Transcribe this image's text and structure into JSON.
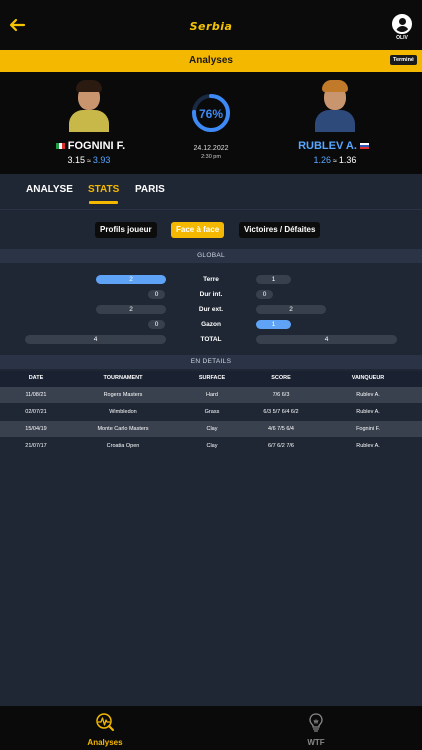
{
  "header": {
    "brand": "Serbia",
    "user_name": "OLIV"
  },
  "subheader": {
    "title": "Analyses",
    "status_badge": "Terminé"
  },
  "match": {
    "player1": {
      "name": "FOGNINI F.",
      "flag": "italy-flag",
      "odds_low": "3.15",
      "odds_sep": "≈",
      "odds_high": "3.93"
    },
    "player2": {
      "name": "RUBLEV A.",
      "flag": "russia-flag",
      "odds_low": "1.26",
      "odds_sep": "≈",
      "odds_high": "1.36"
    },
    "probability": "76%",
    "probability_value": 0.76,
    "date": "24.12.2022",
    "time": "2:30 pm",
    "accent_color": "#3d8af7"
  },
  "tabs": [
    {
      "label": "ANALYSE"
    },
    {
      "label": "STATS"
    },
    {
      "label": "PARIS"
    }
  ],
  "filters": [
    {
      "label": "Profils joueur"
    },
    {
      "label": "Face à face"
    },
    {
      "label": "Victoires / Défaites"
    }
  ],
  "global": {
    "heading": "GLOBAL",
    "rows": [
      {
        "label": "Terre",
        "left": "2",
        "right": "1"
      },
      {
        "label": "Dur int.",
        "left": "0",
        "right": "0"
      },
      {
        "label": "Dur ext.",
        "left": "2",
        "right": "2"
      },
      {
        "label": "Gazon",
        "left": "0",
        "right": "1"
      },
      {
        "label": "TOTAL",
        "left": "4",
        "right": "4"
      }
    ]
  },
  "details": {
    "heading": "EN DETAILS",
    "columns": [
      "DATE",
      "TOURNAMENT",
      "SURFACE",
      "SCORE",
      "VAINQUEUR"
    ],
    "rows": [
      [
        "11/08/21",
        "Rogers Masters",
        "Hard",
        "7/6 6/3",
        "Rublev A."
      ],
      [
        "02/07/21",
        "Wimbledon",
        "Grass",
        "6/3 5/7 6/4 6/2",
        "Rublev A."
      ],
      [
        "15/04/19",
        "Monte Carlo Masters",
        "Clay",
        "4/6 7/5 6/4",
        "Fognini F."
      ],
      [
        "21/07/17",
        "Croatia Open",
        "Clay",
        "6/7 6/2 7/6",
        "Rublev A."
      ]
    ]
  },
  "bottom_nav": [
    {
      "label": "Analyses",
      "icon": "analyses-chart-icon"
    },
    {
      "label": "WTF",
      "icon": "lightbulb-icon"
    }
  ],
  "colors": {
    "brand_yellow": "#f5b800",
    "highlight_blue": "#5ea3f5",
    "background": "#1f2735"
  }
}
